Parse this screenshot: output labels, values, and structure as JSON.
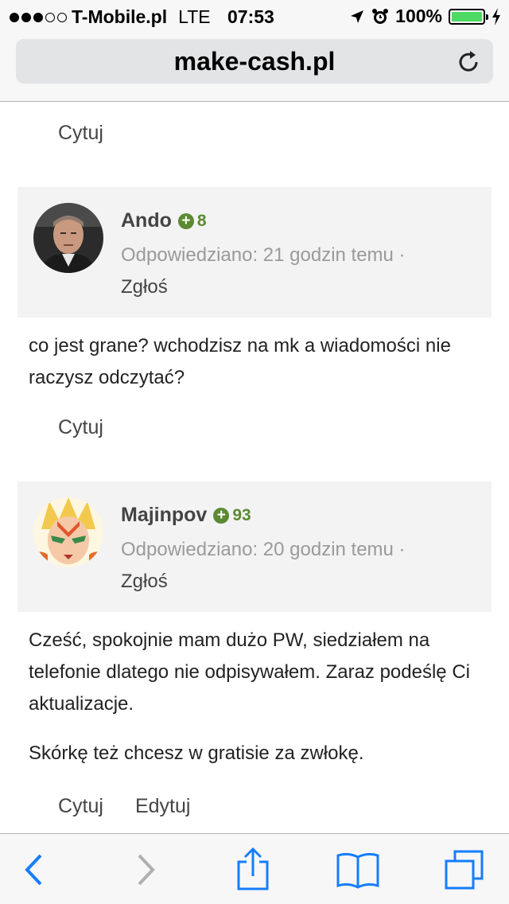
{
  "status_bar": {
    "carrier": "T-Mobile.pl",
    "network": "LTE",
    "time": "07:53",
    "battery": "100%"
  },
  "browser": {
    "address": "make-cash.pl"
  },
  "top_actions": {
    "quote_label": "Cytuj"
  },
  "posts": [
    {
      "author": "Ando",
      "reputation": "8",
      "meta": "Odpowiedziano: 21 godzin temu ·",
      "report": "Zgłoś",
      "body": [
        "co jest grane? wchodzisz na mk a wiadomości nie raczysz odczytać?"
      ],
      "quote_label": "Cytuj"
    },
    {
      "author": "Majinpov",
      "reputation": "93",
      "meta": "Odpowiedziano: 20 godzin temu ·",
      "report": "Zgłoś",
      "body": [
        "Cześć, spokojnie mam dużo PW, siedziałem na telefonie dlatego nie odpisywałem. Zaraz podeślę Ci aktualizacje.",
        "Skórkę też chcesz w gratisie za zwłokę."
      ],
      "quote_label": "Cytuj",
      "edit_label": "Edytuj"
    }
  ]
}
